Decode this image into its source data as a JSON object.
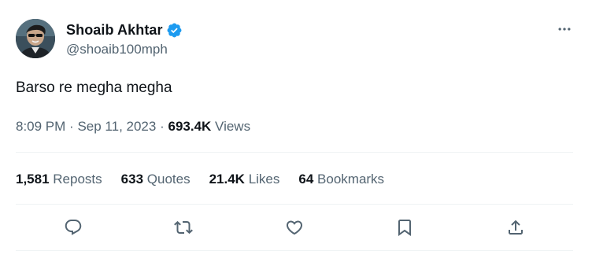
{
  "author": {
    "display_name": "Shoaib Akhtar",
    "handle": "@shoaib100mph",
    "verified": true,
    "avatar_icon": "profile-photo"
  },
  "tweet": {
    "text": "Barso re megha megha"
  },
  "meta": {
    "time": "8:09 PM",
    "separator": "·",
    "date": "Sep 11, 2023",
    "views_count": "693.4K",
    "views_label": "Views"
  },
  "stats": {
    "reposts": {
      "count": "1,581",
      "label": "Reposts"
    },
    "quotes": {
      "count": "633",
      "label": "Quotes"
    },
    "likes": {
      "count": "21.4K",
      "label": "Likes"
    },
    "bookmarks": {
      "count": "64",
      "label": "Bookmarks"
    }
  },
  "actions": [
    "reply-icon",
    "repost-icon",
    "like-icon",
    "bookmark-icon",
    "share-icon"
  ],
  "colors": {
    "text_primary": "#0f1419",
    "text_secondary": "#536471",
    "verified_blue": "#1d9bf0",
    "divider": "#eff3f4"
  }
}
